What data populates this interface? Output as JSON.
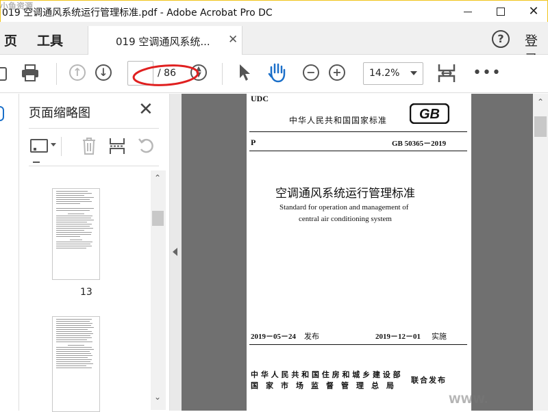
{
  "window": {
    "title": "019 空调通风系统运行管理标准.pdf - Adobe Acrobat Pro DC"
  },
  "nav": {
    "home_label": "页",
    "tools_label": "工具",
    "doc_tab_label": "019 空调通风系统...",
    "help_icon": "help-icon",
    "login_label": "登录"
  },
  "toolbar": {
    "current_page": "",
    "total_pages": "/ 86",
    "zoom": "14.2%"
  },
  "thumbnails": {
    "panel_title": "页面缩略图",
    "items": [
      {
        "page_label": "13"
      },
      {
        "page_label": ""
      }
    ]
  },
  "document": {
    "udc": "UDC",
    "standard_header": "中华人民共和国国家标准",
    "gb_logo": "GB",
    "class_code": "P",
    "standard_number": "GB 50365－2019",
    "title_cn": "空调通风系统运行管理标准",
    "title_en_line1": "Standard for operation and management of",
    "title_en_line2": "central air conditioning system",
    "issue_date": "2019－05－24",
    "issue_word": "发布",
    "impl_date": "2019－12－01",
    "impl_word": "实施",
    "issuer_line1": "中 华 人 民 共 和 国 住 房 和 城 乡 建 设 部",
    "issuer_line2": "国　家　市　场　监　督　管　理　总　局",
    "joint_issue": "联合发布"
  },
  "watermarks": {
    "top_left": "小鱼资源",
    "bottom_right": "WWW."
  },
  "colors": {
    "annotation_red": "#e02020",
    "window_border": "#f0c419",
    "doc_background": "#707070"
  }
}
